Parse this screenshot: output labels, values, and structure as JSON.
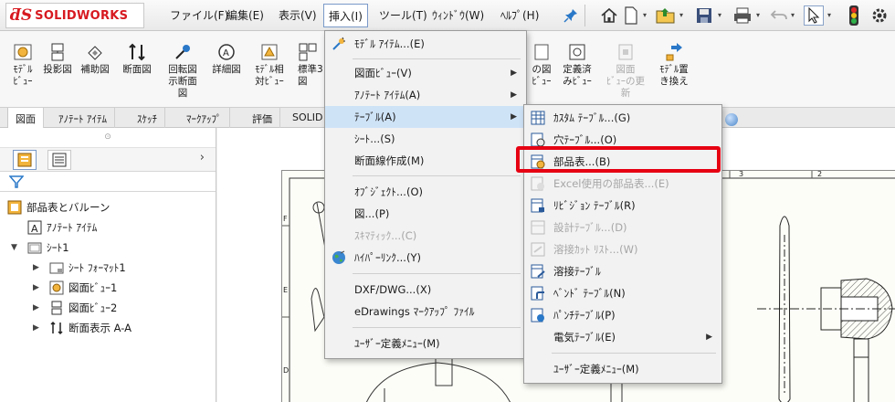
{
  "app": {
    "logo_text": "SOLIDWORKS",
    "accent_color": "#d71920"
  },
  "menubar": [
    {
      "id": "file",
      "label": "ファイル(F)"
    },
    {
      "id": "edit",
      "label": "編集(E)"
    },
    {
      "id": "view",
      "label": "表示(V)"
    },
    {
      "id": "insert",
      "label": "挿入(I)"
    },
    {
      "id": "tools",
      "label": "ツール(T)"
    },
    {
      "id": "window",
      "label": "ｳｨﾝﾄﾞｳ(W)"
    },
    {
      "id": "help",
      "label": "ﾍﾙﾌﾟ(H)"
    }
  ],
  "ribbon": [
    {
      "label": "ﾓﾃﾞﾙ\nﾋﾞｭｰ",
      "icon": "model-view-icon"
    },
    {
      "label": "投影図",
      "icon": "projected-view-icon"
    },
    {
      "label": "補助図",
      "icon": "auxiliary-view-icon"
    },
    {
      "label": "断面図",
      "icon": "section-view-icon"
    },
    {
      "label": "回転図\n示断面\n図",
      "icon": "revolved-section-icon"
    },
    {
      "label": "詳細図",
      "icon": "detail-view-icon"
    },
    {
      "label": "ﾓﾃﾞﾙ相\n対ﾋﾞｭｰ",
      "icon": "relative-view-icon"
    },
    {
      "label": "標準3\n図",
      "icon": "standard-3view-icon"
    },
    {
      "label": "の図\nﾋﾞｭｰ",
      "icon": "partial-view-icon"
    },
    {
      "label": "定義済\nみﾋﾞｭｰ",
      "icon": "predefined-view-icon"
    },
    {
      "label": "図面\nﾋﾞｭｰの更\n新",
      "icon": "update-view-icon",
      "disabled": true
    },
    {
      "label": "ﾓﾃﾞﾙ置\nき換え",
      "icon": "replace-model-icon"
    }
  ],
  "tabs": [
    {
      "label": "図面",
      "active": true
    },
    {
      "label": "ｱﾉﾃｰﾄ ｱｲﾃﾑ"
    },
    {
      "label": "ｽｹｯﾁ"
    },
    {
      "label": "ﾏｰｸｱｯﾌﾟ"
    },
    {
      "label": "評価"
    },
    {
      "label": "SOLID"
    }
  ],
  "tree": {
    "root": "部品表とバルーン",
    "items": [
      {
        "label": "ｱﾉﾃｰﾄ ｱｲﾃﾑ",
        "level": 1
      },
      {
        "label": "ｼｰﾄ1",
        "level": 0,
        "expanded": true
      },
      {
        "label": "ｼｰﾄ ﾌｫｰﾏｯﾄ1",
        "level": 1
      },
      {
        "label": "図面ﾋﾞｭｰ1",
        "level": 1
      },
      {
        "label": "図面ﾋﾞｭｰ2",
        "level": 1
      },
      {
        "label": "断面表示 A-A",
        "level": 1
      }
    ]
  },
  "insert_menu": [
    {
      "label": "ﾓﾃﾞﾙ ｱｲﾃﾑ...(E)",
      "icon": "model-items-icon"
    },
    {
      "label": "図面ﾋﾞｭｰ(V)",
      "submenu": true
    },
    {
      "label": "ｱﾉﾃｰﾄ ｱｲﾃﾑ(A)",
      "submenu": true
    },
    {
      "label": "ﾃｰﾌﾞﾙ(A)",
      "submenu": true,
      "hover": true
    },
    {
      "label": "ｼｰﾄ...(S)"
    },
    {
      "label": "断面線作成(M)"
    },
    {
      "label": "ｵﾌﾞｼﾞｪｸﾄ...(O)"
    },
    {
      "label": "図...(P)"
    },
    {
      "label": "ｽｷﾏﾃｨｯｸ...(C)",
      "disabled": true
    },
    {
      "label": "ﾊｲﾊﾟｰﾘﾝｸ...(Y)",
      "icon": "hyperlink-icon"
    },
    {
      "label": "DXF/DWG...(X)"
    },
    {
      "label": "eDrawings ﾏｰｸｱｯﾌﾟ ﾌｧｲﾙ"
    },
    {
      "label": "ﾕｰｻﾞｰ定義ﾒﾆｭｰ(M)"
    }
  ],
  "table_menu": [
    {
      "label": "ｶｽﾀﾑ ﾃｰﾌﾞﾙ...(G)",
      "icon": "custom-table-icon"
    },
    {
      "label": "穴ﾃｰﾌﾞﾙ...(O)",
      "icon": "hole-table-icon"
    },
    {
      "label": "部品表...(B)",
      "icon": "bom-icon",
      "highlighted": true
    },
    {
      "label": "Excel使用の部品表...(E)",
      "icon": "excel-bom-icon",
      "disabled": true
    },
    {
      "label": "ﾘﾋﾞｼﾞｮﾝ ﾃｰﾌﾞﾙ(R)",
      "icon": "revision-table-icon"
    },
    {
      "label": "設計ﾃｰﾌﾞﾙ...(D)",
      "icon": "design-table-icon",
      "disabled": true
    },
    {
      "label": "溶接ｶｯﾄ ﾘｽﾄ...(W)",
      "icon": "weld-cutlist-icon",
      "disabled": true
    },
    {
      "label": "溶接ﾃｰﾌﾞﾙ",
      "icon": "weld-table-icon"
    },
    {
      "label": "ﾍﾞﾝﾄﾞ ﾃｰﾌﾞﾙ(N)",
      "icon": "bend-table-icon"
    },
    {
      "label": "ﾊﾟﾝﾁﾃｰﾌﾞﾙ(P)",
      "icon": "punch-table-icon"
    },
    {
      "label": "電気ﾃｰﾌﾞﾙ(E)",
      "submenu": true
    },
    {
      "label": "ﾕｰｻﾞｰ定義ﾒﾆｭｰ(M)"
    }
  ],
  "sheet": {
    "col_labels": [
      "3",
      "2"
    ],
    "row_labels": [
      "F",
      "E",
      "D"
    ]
  },
  "highlight_color": "#e60012"
}
